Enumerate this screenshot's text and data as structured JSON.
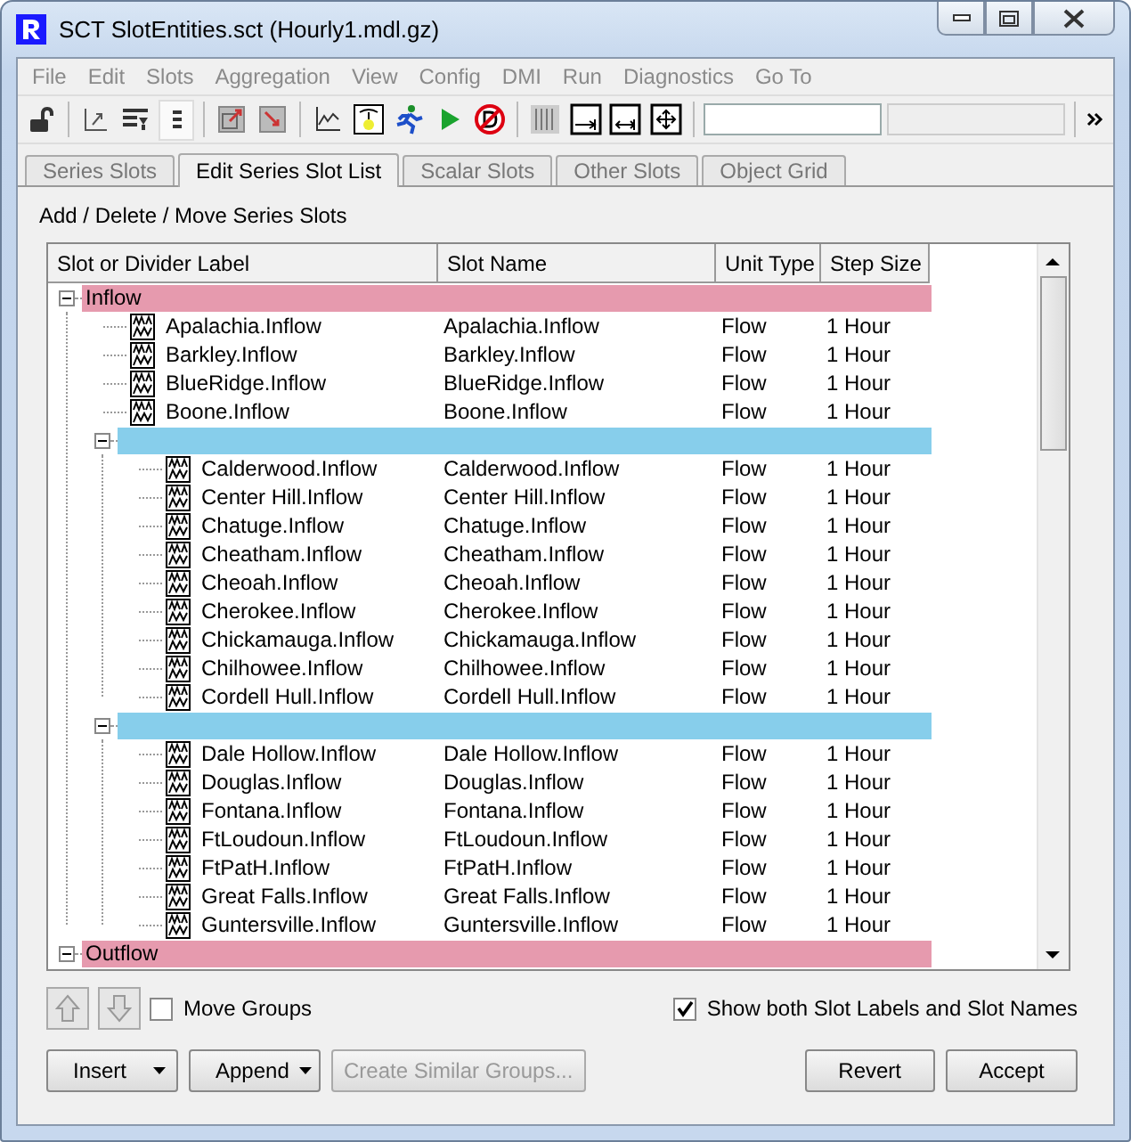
{
  "window": {
    "title": "SCT SlotEntities.sct (Hourly1.mdl.gz)"
  },
  "menu": [
    "File",
    "Edit",
    "Slots",
    "Aggregation",
    "View",
    "Config",
    "DMI",
    "Run",
    "Diagnostics",
    "Go To"
  ],
  "tabs": [
    {
      "label": "Series Slots",
      "selected": false
    },
    {
      "label": "Edit Series Slot List",
      "selected": true
    },
    {
      "label": "Scalar Slots",
      "selected": false
    },
    {
      "label": "Other Slots",
      "selected": false
    },
    {
      "label": "Object Grid",
      "selected": false
    }
  ],
  "section_title": "Add / Delete / Move Series Slots",
  "table": {
    "columns": [
      "Slot or Divider Label",
      "Slot Name",
      "Unit Type",
      "Step Size"
    ],
    "rows": [
      {
        "kind": "divider",
        "label": "Inflow",
        "color": "#e69aae",
        "expanded": true,
        "children": [
          {
            "kind": "slot",
            "label": "Apalachia.Inflow",
            "slot_name": "Apalachia.Inflow",
            "unit_type": "Flow",
            "step_size": "1 Hour"
          },
          {
            "kind": "slot",
            "label": "Barkley.Inflow",
            "slot_name": "Barkley.Inflow",
            "unit_type": "Flow",
            "step_size": "1 Hour"
          },
          {
            "kind": "slot",
            "label": "BlueRidge.Inflow",
            "slot_name": "BlueRidge.Inflow",
            "unit_type": "Flow",
            "step_size": "1 Hour"
          },
          {
            "kind": "slot",
            "label": "Boone.Inflow",
            "slot_name": "Boone.Inflow",
            "unit_type": "Flow",
            "step_size": "1 Hour"
          },
          {
            "kind": "divider",
            "color": "#87ceeb",
            "expanded": true,
            "children": [
              {
                "kind": "slot",
                "label": "Calderwood.Inflow",
                "slot_name": "Calderwood.Inflow",
                "unit_type": "Flow",
                "step_size": "1 Hour"
              },
              {
                "kind": "slot",
                "label": "Center Hill.Inflow",
                "slot_name": "Center Hill.Inflow",
                "unit_type": "Flow",
                "step_size": "1 Hour"
              },
              {
                "kind": "slot",
                "label": "Chatuge.Inflow",
                "slot_name": "Chatuge.Inflow",
                "unit_type": "Flow",
                "step_size": "1 Hour"
              },
              {
                "kind": "slot",
                "label": "Cheatham.Inflow",
                "slot_name": "Cheatham.Inflow",
                "unit_type": "Flow",
                "step_size": "1 Hour"
              },
              {
                "kind": "slot",
                "label": "Cheoah.Inflow",
                "slot_name": "Cheoah.Inflow",
                "unit_type": "Flow",
                "step_size": "1 Hour"
              },
              {
                "kind": "slot",
                "label": "Cherokee.Inflow",
                "slot_name": "Cherokee.Inflow",
                "unit_type": "Flow",
                "step_size": "1 Hour"
              },
              {
                "kind": "slot",
                "label": "Chickamauga.Inflow",
                "slot_name": "Chickamauga.Inflow",
                "unit_type": "Flow",
                "step_size": "1 Hour"
              },
              {
                "kind": "slot",
                "label": "Chilhowee.Inflow",
                "slot_name": "Chilhowee.Inflow",
                "unit_type": "Flow",
                "step_size": "1 Hour"
              },
              {
                "kind": "slot",
                "label": "Cordell Hull.Inflow",
                "slot_name": "Cordell Hull.Inflow",
                "unit_type": "Flow",
                "step_size": "1 Hour"
              }
            ]
          },
          {
            "kind": "divider",
            "color": "#87ceeb",
            "expanded": true,
            "children": [
              {
                "kind": "slot",
                "label": "Dale Hollow.Inflow",
                "slot_name": "Dale Hollow.Inflow",
                "unit_type": "Flow",
                "step_size": "1 Hour"
              },
              {
                "kind": "slot",
                "label": "Douglas.Inflow",
                "slot_name": "Douglas.Inflow",
                "unit_type": "Flow",
                "step_size": "1 Hour"
              },
              {
                "kind": "slot",
                "label": "Fontana.Inflow",
                "slot_name": "Fontana.Inflow",
                "unit_type": "Flow",
                "step_size": "1 Hour"
              },
              {
                "kind": "slot",
                "label": "FtLoudoun.Inflow",
                "slot_name": "FtLoudoun.Inflow",
                "unit_type": "Flow",
                "step_size": "1 Hour"
              },
              {
                "kind": "slot",
                "label": "FtPatH.Inflow",
                "slot_name": "FtPatH.Inflow",
                "unit_type": "Flow",
                "step_size": "1 Hour"
              },
              {
                "kind": "slot",
                "label": "Great Falls.Inflow",
                "slot_name": "Great Falls.Inflow",
                "unit_type": "Flow",
                "step_size": "1 Hour"
              },
              {
                "kind": "slot",
                "label": "Guntersville.Inflow",
                "slot_name": "Guntersville.Inflow",
                "unit_type": "Flow",
                "step_size": "1 Hour"
              }
            ]
          }
        ]
      },
      {
        "kind": "divider",
        "label": "Outflow",
        "color": "#e69aae",
        "expanded": true
      }
    ]
  },
  "options": [
    {
      "label": "Move Groups",
      "checked": false
    },
    {
      "label": "Show both Slot Labels and Slot Names",
      "checked": true
    }
  ],
  "buttons": [
    {
      "label": "Insert",
      "kind": "dropdown",
      "disabled": false
    },
    {
      "label": "Append",
      "kind": "dropdown",
      "disabled": false
    },
    {
      "label": "Create Similar Groups...",
      "kind": "plain",
      "disabled": true
    },
    {
      "label": "Revert",
      "kind": "plain",
      "disabled": false
    },
    {
      "label": "Accept",
      "kind": "plain",
      "disabled": false
    }
  ]
}
